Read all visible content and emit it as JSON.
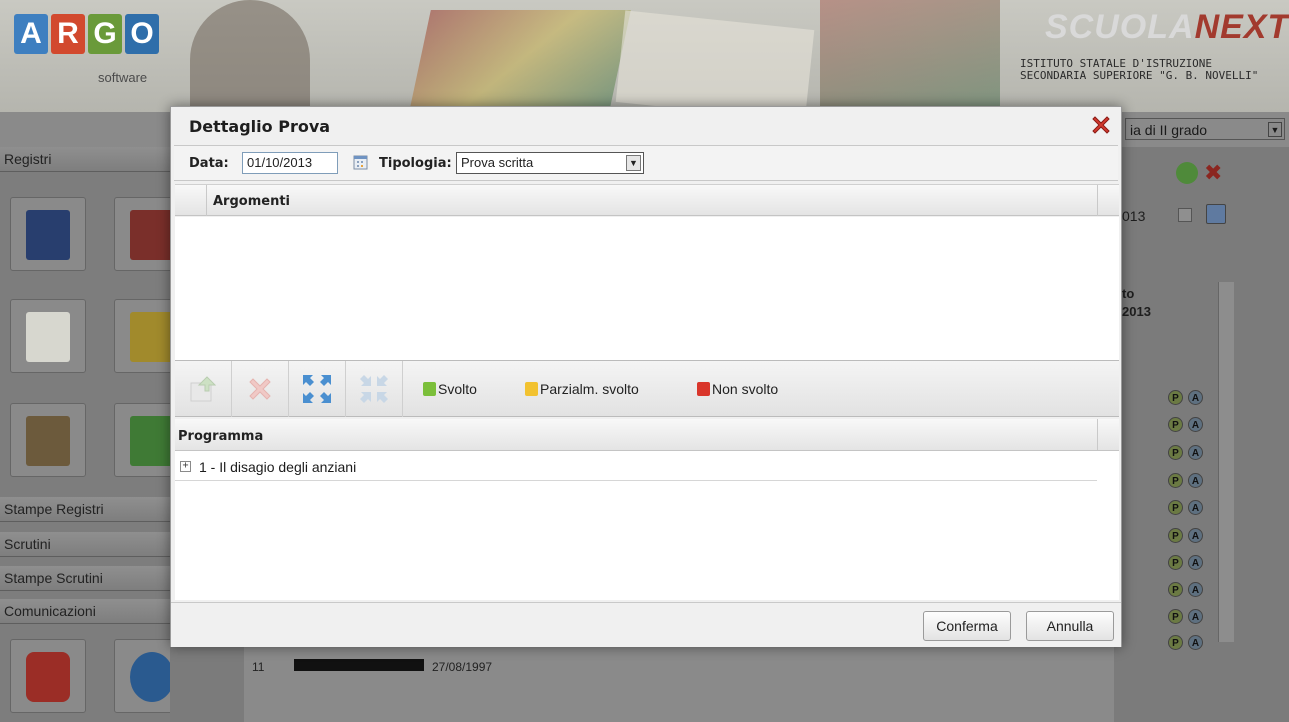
{
  "app": {
    "logo_letters": [
      "A",
      "R",
      "G",
      "O"
    ],
    "logo_colors": [
      "#3e7fc0",
      "#d2492e",
      "#6a9a3a",
      "#2f6eaa"
    ],
    "logo_sub": "software",
    "brand_left": "SCUOLA",
    "brand_right": "NEXT",
    "school_name": "ISTITUTO STATALE D'ISTRUZIONE SECONDARIA SUPERIORE \"G. B. NOVELLI\"",
    "grado_text": "ia di II grado"
  },
  "left_nav": {
    "section_top": "Registri",
    "items": [
      "Stampe Registri",
      "Scrutini",
      "Stampe Scrutini",
      "Comunicazioni"
    ]
  },
  "background": {
    "partial_date": "013",
    "header_partial_1": "to",
    "header_partial_2": "2013",
    "p_label": "P",
    "a_label": "A",
    "row_dates": [
      "27/08/1997"
    ],
    "row_numbers": [
      "11"
    ]
  },
  "dialog": {
    "title": "Dettaglio Prova",
    "filter": {
      "data_label": "Data:",
      "data_value": "01/10/2013",
      "tipologia_label": "Tipologia:",
      "tipologia_value": "Prova scritta"
    },
    "argomenti_header": "Argomenti",
    "legend": {
      "svolto": "Svolto",
      "parzialmente": "Parzialm. svolto",
      "non_svolto": "Non svolto",
      "colors": {
        "svolto": "#7bbf3a",
        "parzialmente": "#f2c230",
        "non_svolto": "#d9362b"
      }
    },
    "programma_header": "Programma",
    "programma_items": [
      {
        "label": "1 - Il disagio degli anziani",
        "expand_glyph": "+"
      }
    ],
    "buttons": {
      "conferma": "Conferma",
      "annulla": "Annulla"
    }
  }
}
